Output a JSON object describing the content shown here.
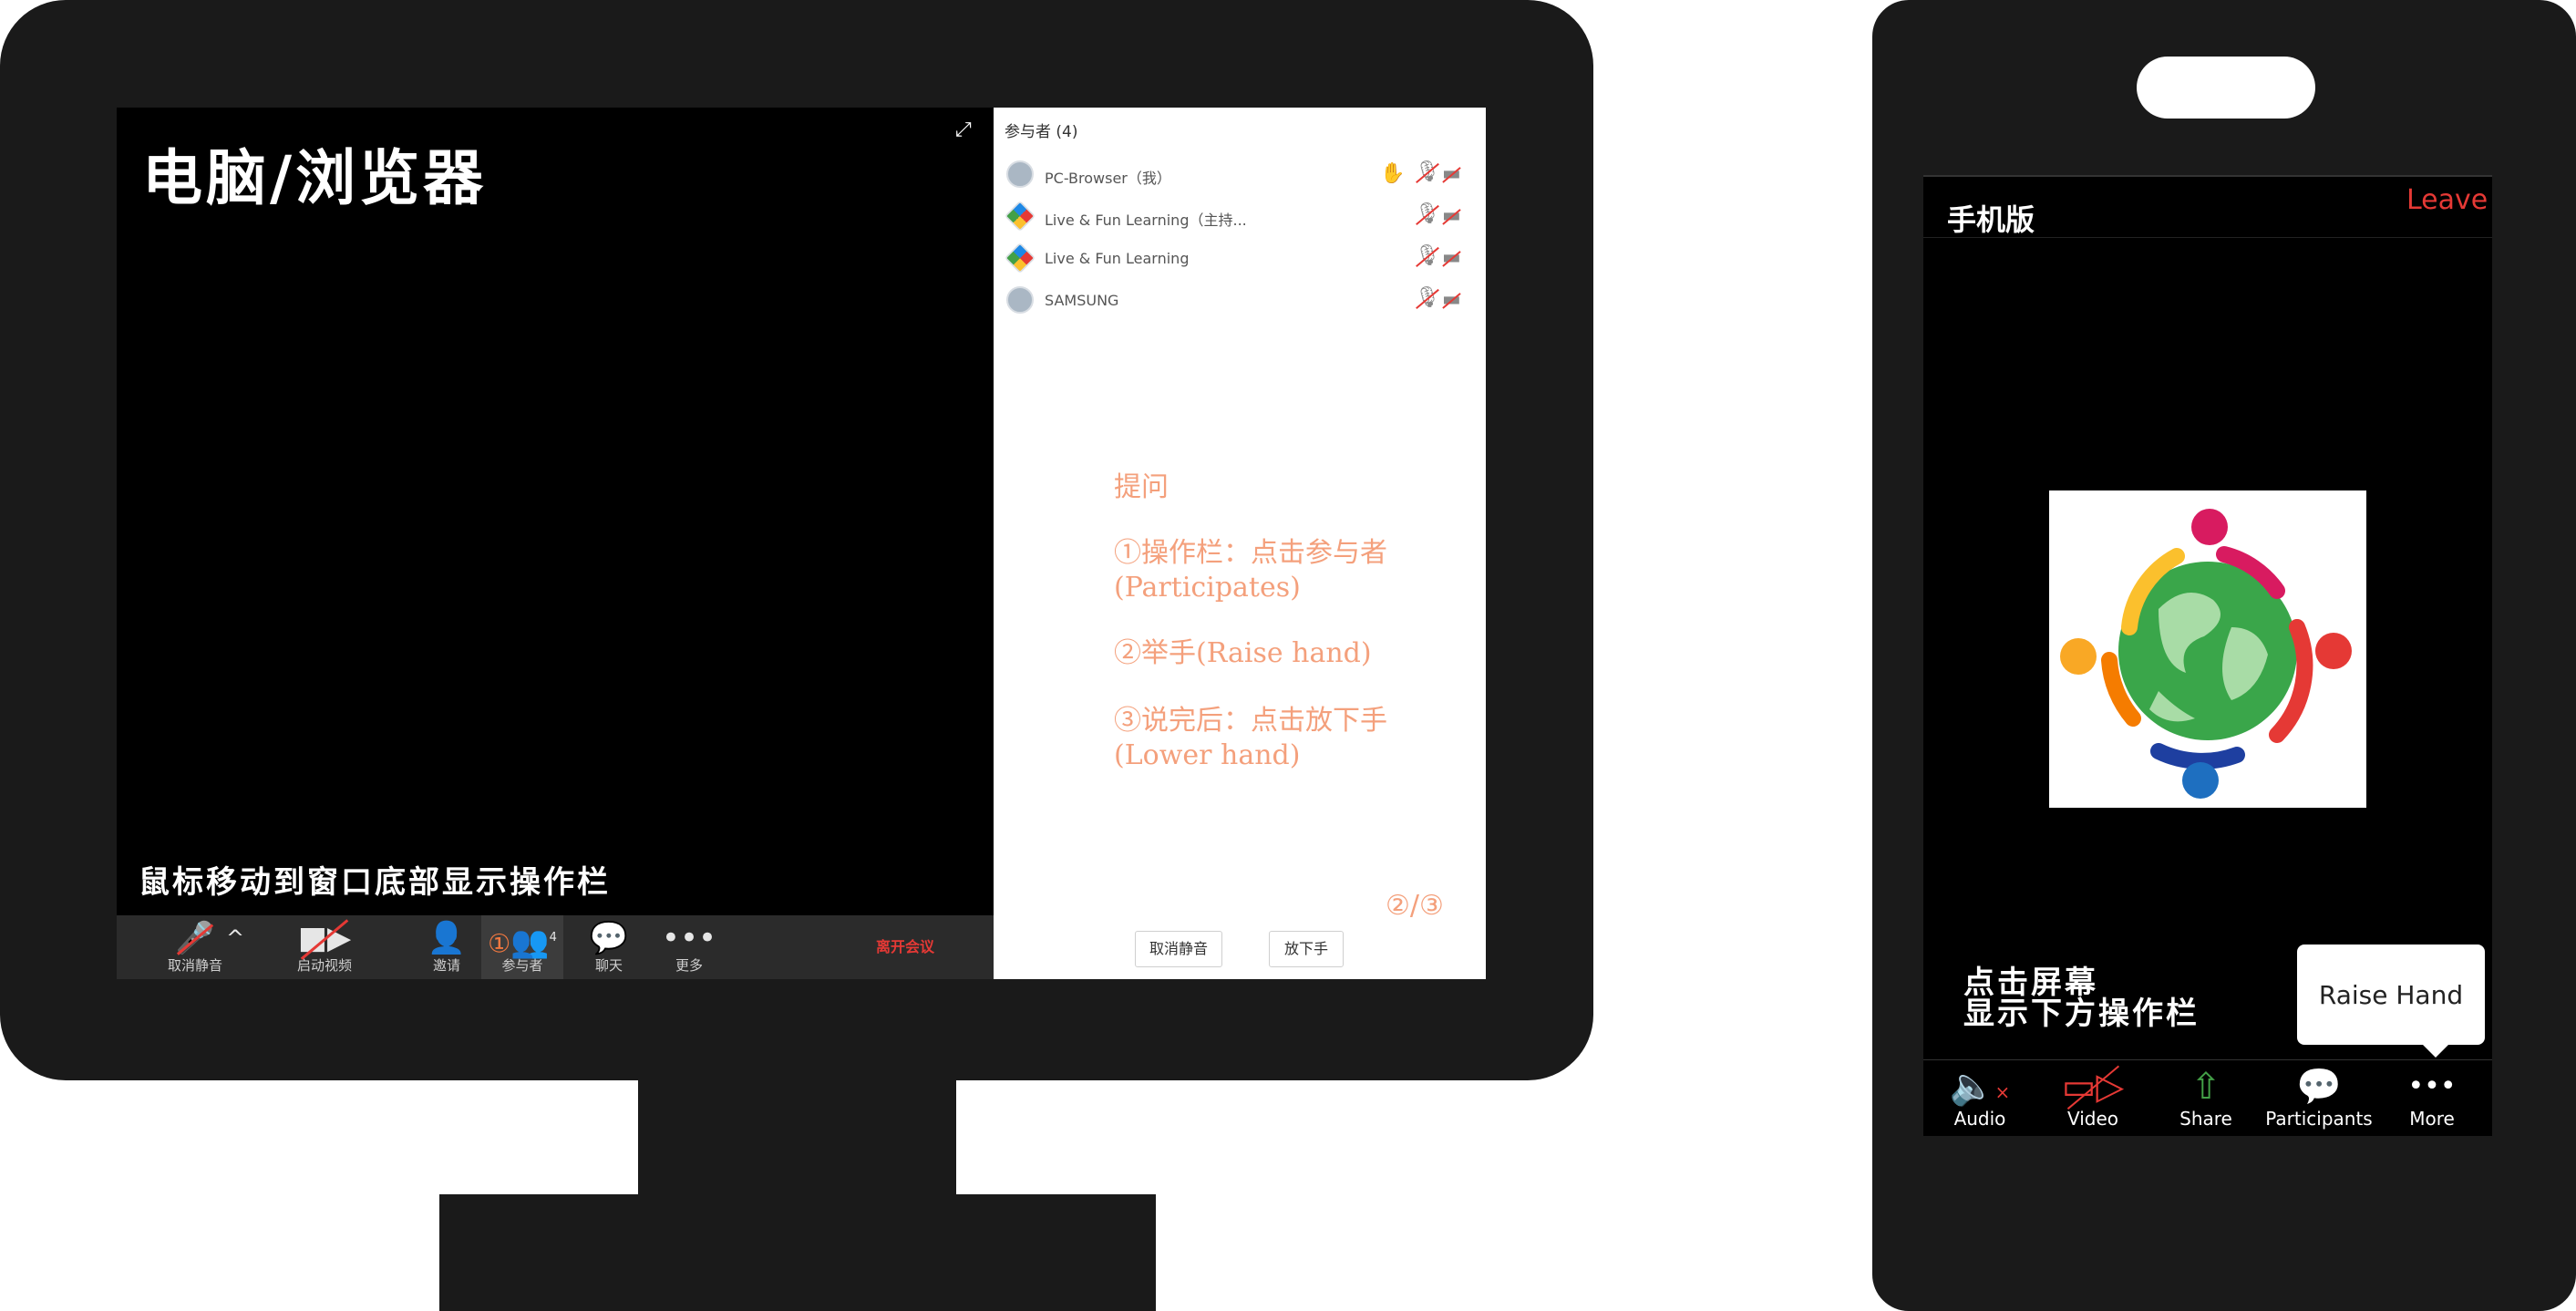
{
  "desktop": {
    "title": "电脑/浏览器",
    "hint": "鼠标移动到窗口底部显示操作栏",
    "fullscreen_icon": "expand-icon",
    "toolbar": {
      "mute_label": "取消静音",
      "video_label": "启动视频",
      "invite_label": "邀请",
      "participants_label": "参与者",
      "participants_count": "4",
      "participants_marker": "①",
      "chat_label": "聊天",
      "more_label": "更多",
      "leave_label": "离开会议"
    },
    "panel": {
      "title": "参与者 (4)",
      "participants": [
        {
          "name": "PC-Browser（我）",
          "hand_raised": true
        },
        {
          "name": "Live & Fun Learning（主持...",
          "hand_raised": false
        },
        {
          "name": "Live & Fun Learning",
          "hand_raised": false
        },
        {
          "name": "SAMSUNG",
          "hand_raised": false
        }
      ],
      "tips": {
        "title": "提问",
        "step1_line1": "①操作栏：点击参与者",
        "step1_line2": "(Participates)",
        "step2": "②举手(Raise hand)",
        "step3_line1": "③说完后：点击放下手",
        "step3_line2": "(Lower hand)"
      },
      "marker": "②/③",
      "unmute_button": "取消静音",
      "lower_hand_button": "放下手"
    }
  },
  "phone": {
    "title": "手机版",
    "leave_label": "Leave",
    "hint_line1": "点击屏幕",
    "hint_line2": "显示下方操作栏",
    "raise_hand_label": "Raise Hand",
    "toolbar": {
      "audio_label": "Audio",
      "video_label": "Video",
      "share_label": "Share",
      "participants_label": "Participants",
      "more_label": "More"
    }
  },
  "colors": {
    "frame": "#1a1a1a",
    "accent_red": "#e53935",
    "tip_orange": "#f4a07c",
    "share_green": "#43a047"
  }
}
